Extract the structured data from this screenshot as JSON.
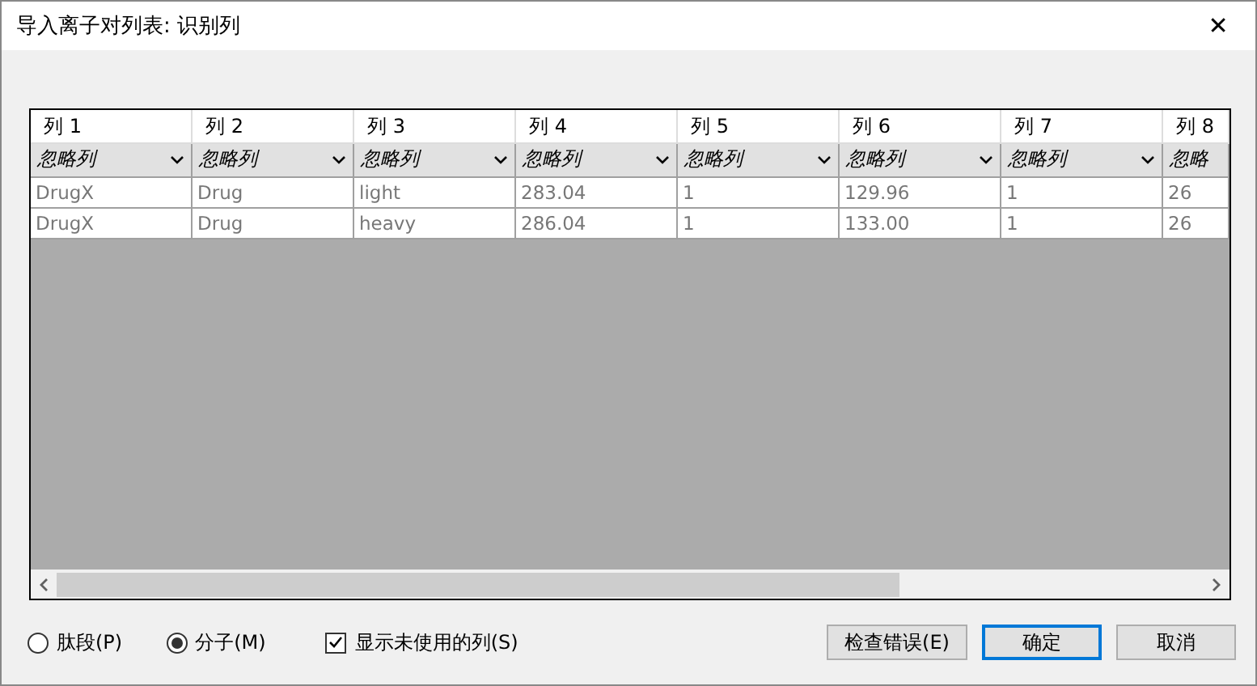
{
  "window": {
    "title": "导入离子对列表: 识别列",
    "close": "✕"
  },
  "table": {
    "columns": [
      {
        "header": "列 1",
        "role": "忽略列",
        "cut_off": false
      },
      {
        "header": "列 2",
        "role": "忽略列",
        "cut_off": false
      },
      {
        "header": "列 3",
        "role": "忽略列",
        "cut_off": false
      },
      {
        "header": "列 4",
        "role": "忽略列",
        "cut_off": false
      },
      {
        "header": "列 5",
        "role": "忽略列",
        "cut_off": false
      },
      {
        "header": "列 6",
        "role": "忽略列",
        "cut_off": false
      },
      {
        "header": "列 7",
        "role": "忽略列",
        "cut_off": false
      },
      {
        "header": "列 8",
        "role": "忽略",
        "cut_off": true
      }
    ],
    "rows": [
      {
        "cells": [
          "DrugX",
          "Drug",
          "light",
          "283.04",
          "1",
          "129.96",
          "1",
          "26"
        ]
      },
      {
        "cells": [
          "DrugX",
          "Drug",
          "heavy",
          "286.04",
          "1",
          "133.00",
          "1",
          "26"
        ]
      }
    ]
  },
  "options": {
    "radios": [
      {
        "label": "肽段(P)",
        "selected": false
      },
      {
        "label": "分子(M)",
        "selected": true
      }
    ],
    "checkbox": {
      "label": "显示未使用的列(S)",
      "checked": true
    }
  },
  "buttons": [
    {
      "label": "检查错误(E)",
      "default": false
    },
    {
      "label": "确定",
      "default": true
    },
    {
      "label": "取消",
      "default": false
    }
  ]
}
